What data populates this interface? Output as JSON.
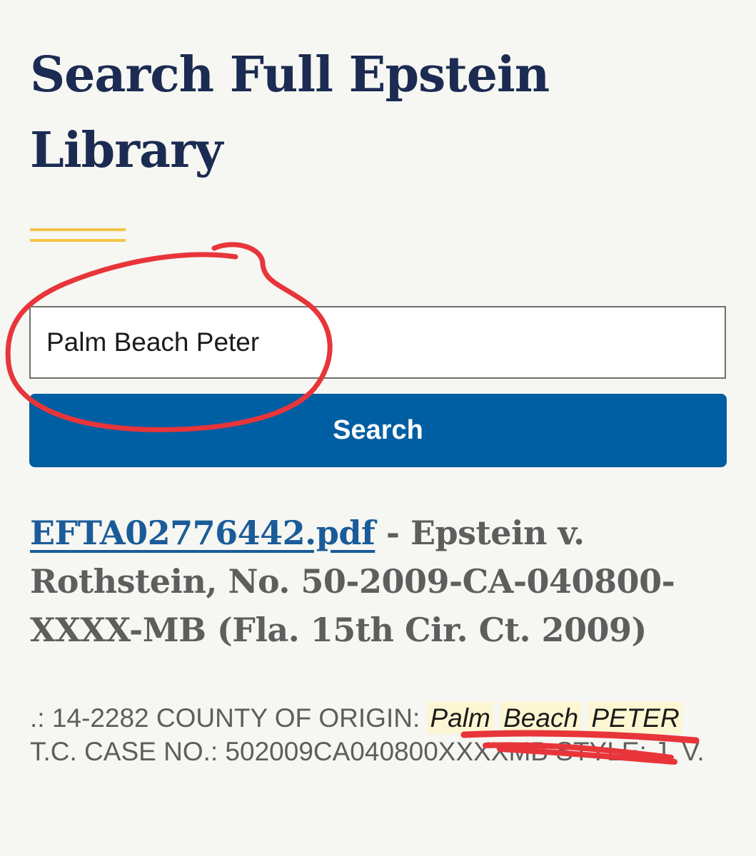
{
  "page": {
    "title": "Search Full Epstein Library"
  },
  "search": {
    "value": "Palm Beach Peter",
    "button_label": "Search"
  },
  "result": {
    "link_text": "EFTA02776442.pdf",
    "separator": " - ",
    "description": "Epstein v. Rothstein, No. 50-2009-CA-040800-XXXX-MB (Fla. 15th Cir. Ct. 2009)",
    "snippet_pre": ".: 14-2282 COUNTY OF ORIGIN: ",
    "snippet_hl": [
      "Palm",
      "Beach",
      "PETER"
    ],
    "snippet_post": "T.C. CASE NO.: 502009CA040800XXXXMB STYLE: J. V."
  },
  "colors": {
    "page_bg": "#f6f6f2",
    "title": "#1b2b52",
    "accent_bar": "#f2c648",
    "button": "#005ea2",
    "link": "#1a5c99",
    "muted_text": "#5e5e5e",
    "highlight": "#fcf6d2",
    "annotation": "#e8353a"
  }
}
